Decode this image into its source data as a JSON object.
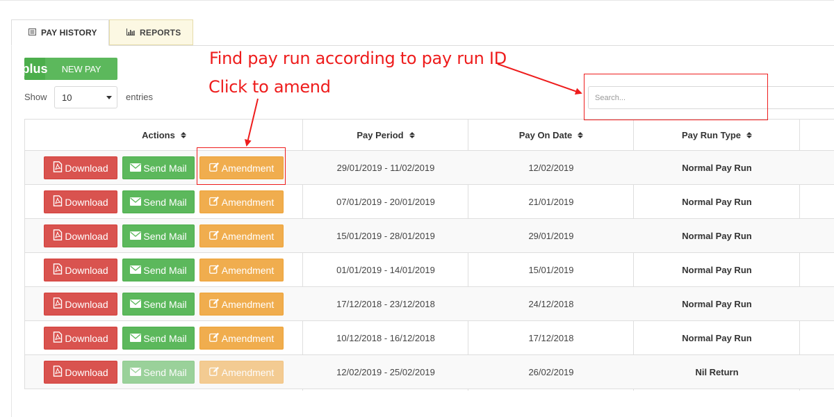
{
  "tabs": [
    {
      "label": "PAY HISTORY",
      "icon": "list-icon",
      "active": true
    },
    {
      "label": "REPORTS",
      "icon": "bar-chart-icon",
      "active": false
    }
  ],
  "toolbar": {
    "new_pay_label": "NEW PAY",
    "new_pay_icon": "plus"
  },
  "length_menu": {
    "show_label": "Show",
    "selected": "10",
    "entries_label": "entries"
  },
  "search": {
    "placeholder": "Search..."
  },
  "table": {
    "columns": [
      "Actions",
      "Pay Period",
      "Pay On Date",
      "Pay Run Type"
    ],
    "action_labels": {
      "download": "Download",
      "send_mail": "Send Mail",
      "amendment": "Amendment"
    },
    "rows": [
      {
        "pay_period": "29/01/2019 - 11/02/2019",
        "pay_on_date": "12/02/2019",
        "pay_run_type": "Normal Pay Run",
        "actions_enabled": true
      },
      {
        "pay_period": "07/01/2019 - 20/01/2019",
        "pay_on_date": "21/01/2019",
        "pay_run_type": "Normal Pay Run",
        "actions_enabled": true
      },
      {
        "pay_period": "15/01/2019 - 28/01/2019",
        "pay_on_date": "29/01/2019",
        "pay_run_type": "Normal Pay Run",
        "actions_enabled": true
      },
      {
        "pay_period": "01/01/2019 - 14/01/2019",
        "pay_on_date": "15/01/2019",
        "pay_run_type": "Normal Pay Run",
        "actions_enabled": true
      },
      {
        "pay_period": "17/12/2018 - 23/12/2018",
        "pay_on_date": "24/12/2018",
        "pay_run_type": "Normal Pay Run",
        "actions_enabled": true
      },
      {
        "pay_period": "10/12/2018 - 16/12/2018",
        "pay_on_date": "17/12/2018",
        "pay_run_type": "Normal Pay Run",
        "actions_enabled": true
      },
      {
        "pay_period": "12/02/2019 - 25/02/2019",
        "pay_on_date": "26/02/2019",
        "pay_run_type": "Nil Return",
        "actions_enabled": false
      }
    ]
  },
  "annotations": {
    "search_note": "Find pay run according to pay run ID",
    "amend_note": "Click to amend",
    "color": "#ee1c1c"
  },
  "colors": {
    "download": "#d9534f",
    "send_mail": "#5cb85c",
    "amendment": "#f0ad4e",
    "reports_tab_bg": "#fcf8e3"
  }
}
